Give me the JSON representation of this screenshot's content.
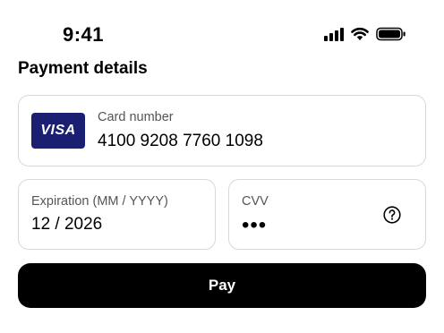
{
  "status_bar": {
    "time": "9:41",
    "icons": [
      "cellular-signal-icon",
      "wifi-icon",
      "battery-icon"
    ]
  },
  "form": {
    "title": "Payment details",
    "card": {
      "brand": "VISA",
      "brand_color": "#1a1f71",
      "label": "Card number",
      "value": "4100 9208 7760 1098"
    },
    "expiration": {
      "label": "Expiration (MM / YYYY)",
      "value": "12 / 2026"
    },
    "cvv": {
      "label": "CVV",
      "value": "•••",
      "help_icon": "help-circle-icon"
    },
    "pay_button": {
      "label": "Pay"
    }
  }
}
